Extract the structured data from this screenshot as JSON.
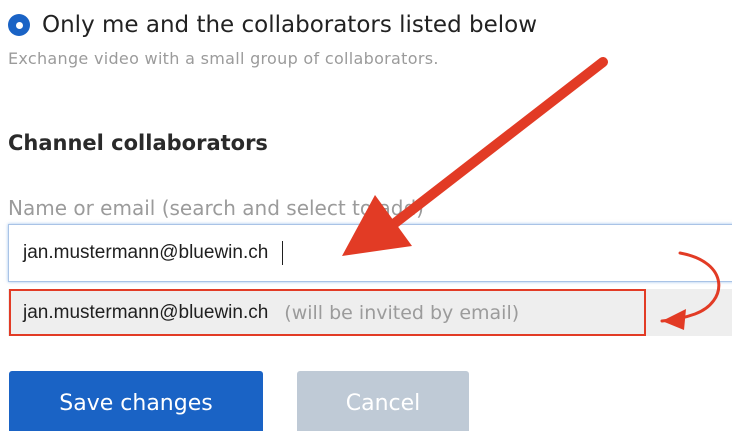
{
  "visibility_option": {
    "label": "Only me and the collaborators listed below",
    "description": "Exchange video with a small group of collaborators.",
    "selected": true
  },
  "collaborators": {
    "section_title": "Channel collaborators",
    "field_label": "Name or email (search and select to add)",
    "input_value": "jan.mustermann@bluewin.ch",
    "suggestion": {
      "email": "jan.mustermann@bluewin.ch",
      "note": "(will be invited by email)"
    }
  },
  "actions": {
    "save_label": "Save changes",
    "cancel_label": "Cancel"
  },
  "colors": {
    "accent": "#1a63c5",
    "annotation": "#e23b25",
    "cancel_disabled": "#bfcad6"
  }
}
